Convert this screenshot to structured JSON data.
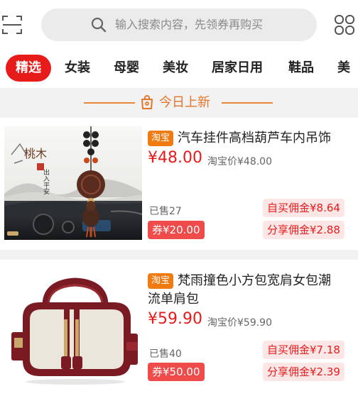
{
  "search": {
    "placeholder": "输入搜索内容，先领券再购买"
  },
  "tabs": [
    {
      "label": "精选",
      "active": true
    },
    {
      "label": "女装"
    },
    {
      "label": "母婴"
    },
    {
      "label": "美妆"
    },
    {
      "label": "居家日用"
    },
    {
      "label": "鞋品"
    },
    {
      "label": "美"
    }
  ],
  "banner": {
    "title": "今日上新"
  },
  "products": [
    {
      "platform": "淘宝",
      "title": "汽车挂件高档葫芦车内吊饰",
      "price": "¥48.00",
      "orig_price": "淘宝价¥48.00",
      "sold": "已售27",
      "coupon": "券¥20.00",
      "self_commission": "自买佣金¥8.64",
      "share_commission": "分享佣金¥2.88",
      "image_text": {
        "main": "桃木",
        "side": "出入平安"
      }
    },
    {
      "platform": "淘宝",
      "title_line1": "梵雨撞色小方包宽肩女包潮",
      "title_line2": "流单肩包",
      "price": "¥59.90",
      "orig_price": "淘宝价¥59.90",
      "sold": "已售40",
      "coupon": "券¥50.00",
      "self_commission": "自买佣金¥7.18",
      "share_commission": "分享佣金¥2.39"
    }
  ],
  "colors": {
    "accent": "#e81b1b",
    "badge": "#ef7b12",
    "banner": "#e8742a"
  }
}
